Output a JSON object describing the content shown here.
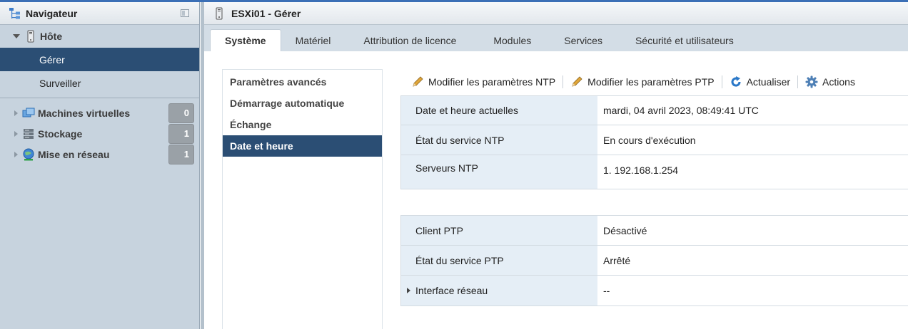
{
  "navigator": {
    "title": "Navigateur",
    "host_label": "Hôte",
    "host_items": [
      {
        "label": "Gérer",
        "selected": true
      },
      {
        "label": "Surveiller",
        "selected": false
      }
    ],
    "groups": [
      {
        "label": "Machines virtuelles",
        "count": "0",
        "icon": "virtual-machines-icon"
      },
      {
        "label": "Stockage",
        "count": "1",
        "icon": "storage-icon"
      },
      {
        "label": "Mise en réseau",
        "count": "1",
        "icon": "network-globe-icon"
      }
    ]
  },
  "main": {
    "title": "ESXi01 - Gérer",
    "tabs": [
      {
        "label": "Système",
        "active": true
      },
      {
        "label": "Matériel"
      },
      {
        "label": "Attribution de licence"
      },
      {
        "label": "Modules"
      },
      {
        "label": "Services"
      },
      {
        "label": "Sécurité et utilisateurs"
      }
    ],
    "subnav": [
      {
        "label": "Paramètres avancés"
      },
      {
        "label": "Démarrage automatique"
      },
      {
        "label": "Échange"
      },
      {
        "label": "Date et heure",
        "selected": true
      }
    ],
    "toolbar": {
      "edit_ntp": "Modifier les paramètres NTP",
      "edit_ptp": "Modifier les paramètres PTP",
      "refresh": "Actualiser",
      "actions": "Actions"
    },
    "ntp_table": [
      {
        "key": "Date et heure actuelles",
        "value": "mardi, 04 avril 2023, 08:49:41 UTC"
      },
      {
        "key": "État du service NTP",
        "value": "En cours d'exécution"
      },
      {
        "key": "Serveurs NTP",
        "value": "1. 192.168.1.254"
      }
    ],
    "ptp_table": [
      {
        "key": "Client PTP",
        "value": "Désactivé"
      },
      {
        "key": "État du service PTP",
        "value": "Arrêté"
      },
      {
        "key": "Interface réseau",
        "value": "--"
      }
    ]
  },
  "colors": {
    "selection": "#2b4e74",
    "nav_bg": "#c7d3de",
    "tab_bar": "#d3dde6",
    "key_cell": "#e5eef6"
  }
}
